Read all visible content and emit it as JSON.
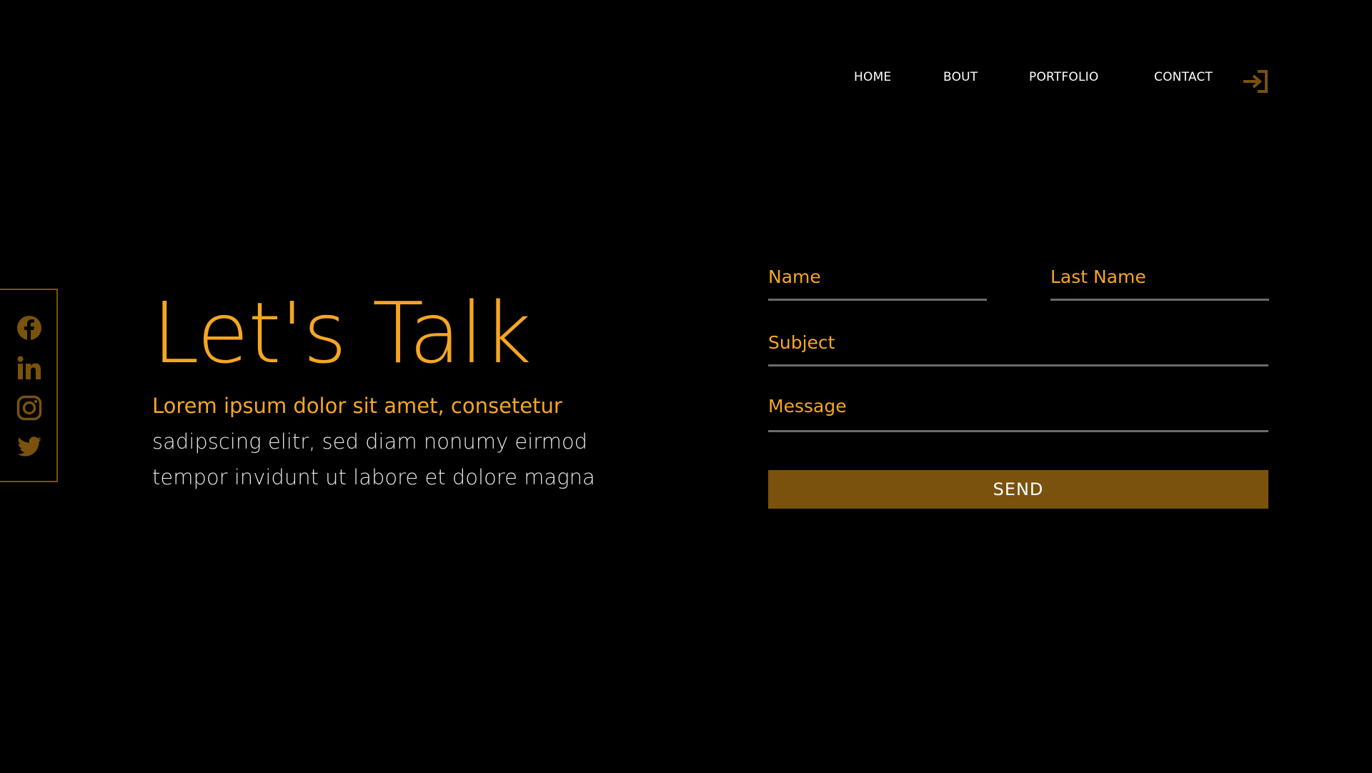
{
  "nav": {
    "items": [
      {
        "label": "HOME"
      },
      {
        "label": "BOUT"
      },
      {
        "label": "PORTFOLIO"
      },
      {
        "label": "CONTACT"
      }
    ],
    "login_icon": "login-arrow-icon"
  },
  "social": {
    "icons": [
      "facebook-icon",
      "linkedin-icon",
      "instagram-icon",
      "twitter-icon"
    ]
  },
  "hero": {
    "title": "Let's Talk",
    "line1": "Lorem ipsum dolor sit amet, consetetur",
    "line2": "sadipscing elitr, sed diam nonumy eirmod",
    "line3": "tempor invidunt ut labore et dolore magna"
  },
  "form": {
    "name_placeholder": "Name",
    "lastname_placeholder": "Last Name",
    "subject_placeholder": "Subject",
    "message_placeholder": "Message",
    "send_label": "SEND"
  },
  "colors": {
    "background": "#000000",
    "accent": "#f5a623",
    "accent_dark": "#7a520d",
    "underline": "#6b6b6b",
    "text": "#ffffff"
  }
}
